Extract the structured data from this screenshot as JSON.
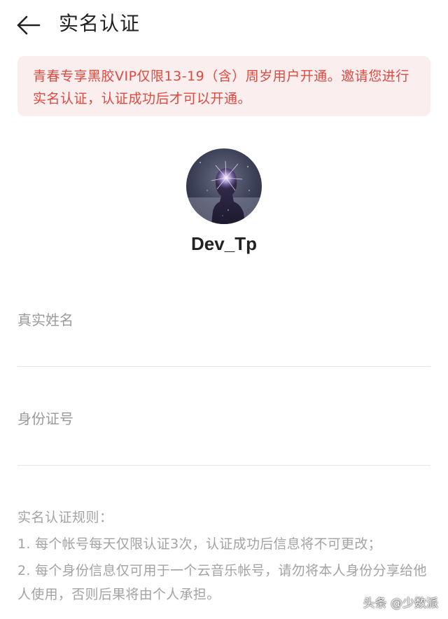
{
  "header": {
    "title": "实名认证",
    "back_icon": "arrow-left-icon"
  },
  "notice": {
    "text": "青春专享黑胶VIP仅限13-19（含）周岁用户开通。邀请您进行实名认证，认证成功后才可以开通。",
    "color": "#e0493f",
    "background": "#fbeeee"
  },
  "profile": {
    "username": "Dev_Tp"
  },
  "form": {
    "name_placeholder": "真实姓名",
    "name_value": "",
    "id_placeholder": "身份证号",
    "id_value": ""
  },
  "rules": {
    "title": "实名认证规则：",
    "items": [
      "1. 每个帐号每天仅限认证3次，认证成功后信息将不可更改；",
      "2. 每个身份信息仅可用于一个云音乐帐号，请勿将本人身份分享给他人使用，否则后果将由个人承担。"
    ]
  },
  "watermark": {
    "text": "头条 @少数派"
  }
}
